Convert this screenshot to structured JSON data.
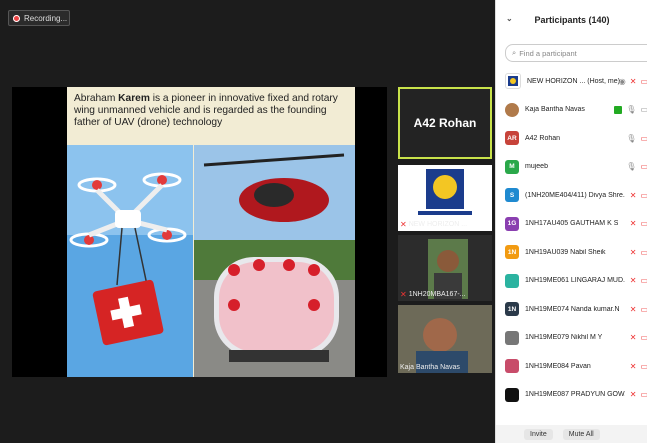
{
  "recording": {
    "label": "Recording..."
  },
  "slide": {
    "text_parts": [
      "Abraham ",
      "Karem",
      " is a pioneer in innovative fixed and rotary wing unmanned vehicle and is regarded as the founding father of UAV (drone) technology"
    ]
  },
  "tiles": [
    {
      "name": "A42 Rohan"
    },
    {
      "label": "NEW HORIZON ..."
    },
    {
      "label": "1NH20MBA167-..."
    },
    {
      "label": "Kaja Bantha Navas"
    }
  ],
  "participants": {
    "title": "Participants (140)",
    "search_placeholder": "Find a participant",
    "items": [
      {
        "name": "NEW HORIZON ... (Host, me)",
        "avatar": "",
        "color": "#ffffff"
      },
      {
        "name": "Kaja Bantha Navas",
        "avatar": "",
        "color": "#b07a4a"
      },
      {
        "name": "A42 Rohan",
        "avatar": "AR",
        "color": "#c7433a"
      },
      {
        "name": "mujeeb",
        "avatar": "M",
        "color": "#2aa84a"
      },
      {
        "name": "(1NH20ME404/411) Divya Shre...",
        "avatar": "S",
        "color": "#1f8ad0"
      },
      {
        "name": "1NH17AU405 GAUTHAM K S",
        "avatar": "1G",
        "color": "#8a3fb0"
      },
      {
        "name": "1NH19AU039 Nabil Sheik",
        "avatar": "1N",
        "color": "#f29b12"
      },
      {
        "name": "1NH19ME061 LINGARAJ MUD...",
        "avatar": "",
        "color": "#2bb3a0"
      },
      {
        "name": "1NH19ME074 Nanda kumar.N",
        "avatar": "1N",
        "color": "#2b3a4a"
      },
      {
        "name": "1NH19ME079 Nikhil M Y",
        "avatar": "",
        "color": "#777777"
      },
      {
        "name": "1NH19ME084 Pavan",
        "avatar": "",
        "color": "#c84c6a"
      },
      {
        "name": "1NH19ME087 PRADYUN GOW...",
        "avatar": "",
        "color": "#111111"
      }
    ]
  },
  "footer": {
    "invite": "Invite",
    "mute_all": "Mute All"
  }
}
